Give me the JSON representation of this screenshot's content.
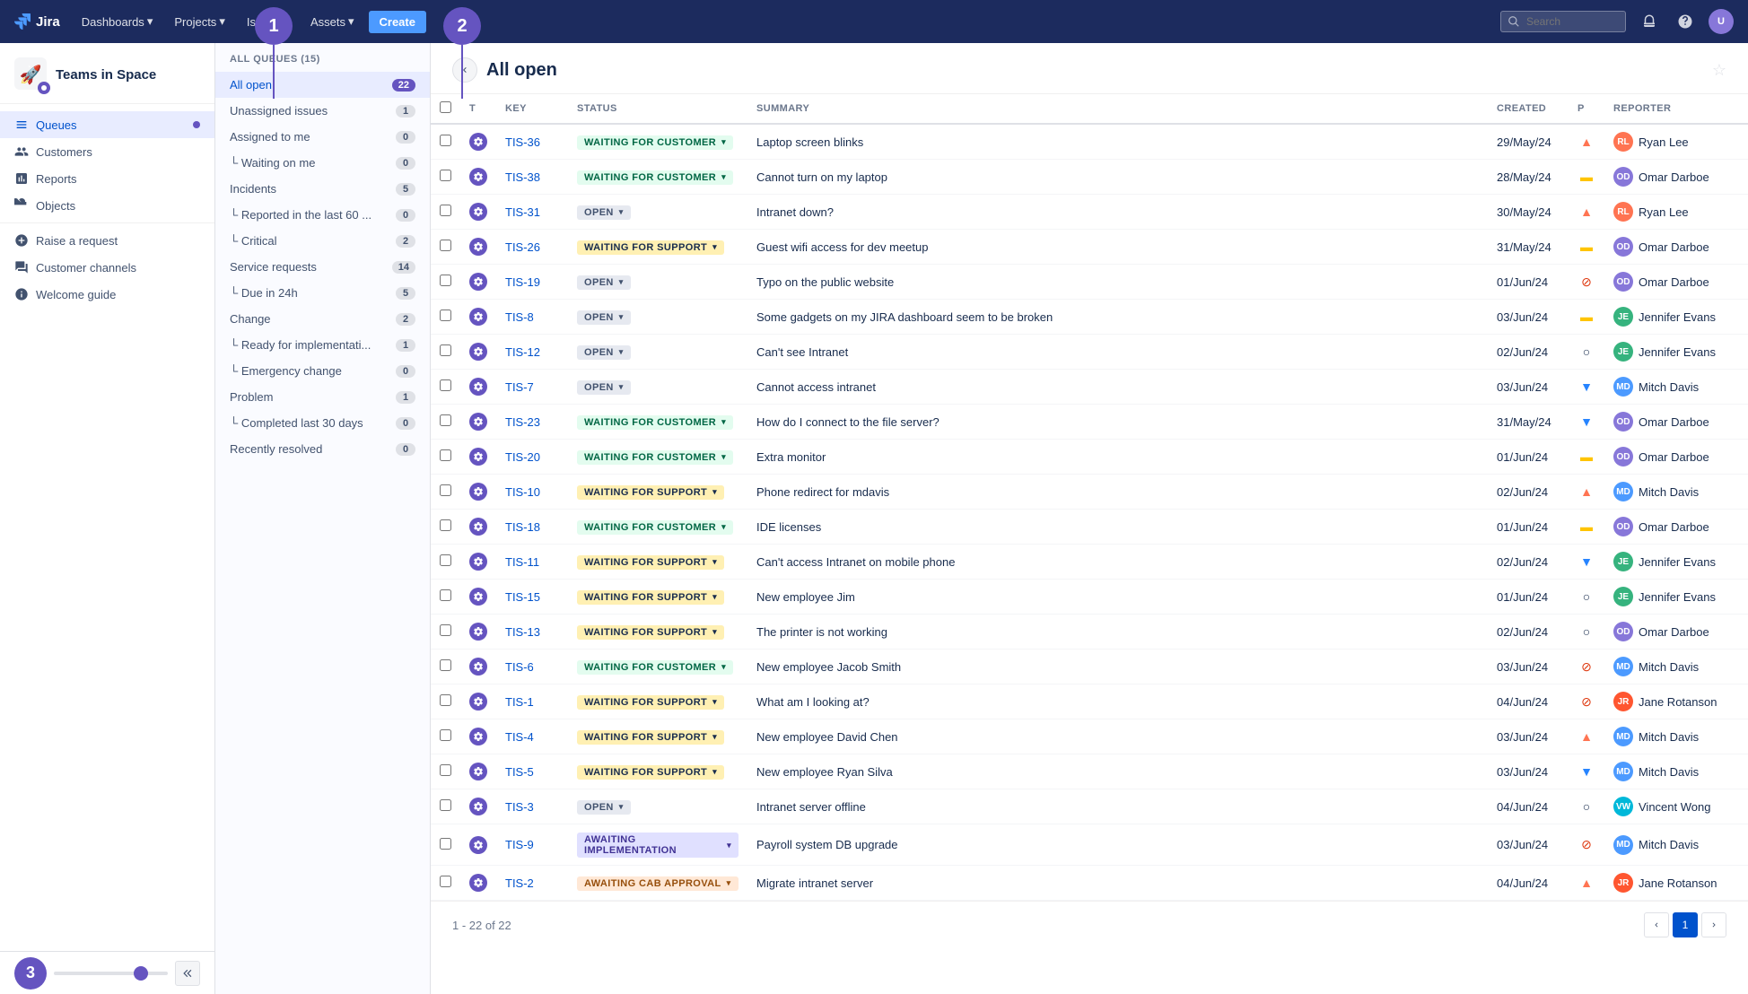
{
  "topnav": {
    "logo_text": "Jira",
    "dashboards": "Dashboards",
    "projects": "Projects",
    "issues": "Issues",
    "assets": "Assets",
    "create": "Create",
    "search_placeholder": "Search"
  },
  "sidebar": {
    "project_name": "Teams in Space",
    "nav_items": [
      {
        "id": "queues",
        "label": "Queues",
        "active": true
      },
      {
        "id": "customers",
        "label": "Customers",
        "active": false
      },
      {
        "id": "reports",
        "label": "Reports",
        "active": false
      },
      {
        "id": "objects",
        "label": "Objects",
        "active": false
      }
    ],
    "actions": [
      {
        "id": "raise-request",
        "label": "Raise a request"
      },
      {
        "id": "customer-channels",
        "label": "Customer channels"
      },
      {
        "id": "welcome-guide",
        "label": "Welcome guide"
      }
    ]
  },
  "queues_panel": {
    "header": "ALL QUEUES (15)",
    "items": [
      {
        "id": "all-open",
        "label": "All open",
        "count": "22",
        "indent": false,
        "active": true
      },
      {
        "id": "unassigned",
        "label": "Unassigned issues",
        "count": "1",
        "indent": false,
        "active": false
      },
      {
        "id": "assigned-to-me",
        "label": "Assigned to me",
        "count": "0",
        "indent": false,
        "active": false
      },
      {
        "id": "waiting-on-me",
        "label": "└ Waiting on me",
        "count": "0",
        "indent": true,
        "active": false
      },
      {
        "id": "incidents",
        "label": "Incidents",
        "count": "5",
        "indent": false,
        "active": false
      },
      {
        "id": "reported-last-60",
        "label": "└ Reported in the last 60 ...",
        "count": "0",
        "indent": true,
        "active": false
      },
      {
        "id": "critical",
        "label": "└ Critical",
        "count": "2",
        "indent": true,
        "active": false
      },
      {
        "id": "service-requests",
        "label": "Service requests",
        "count": "14",
        "indent": false,
        "active": false
      },
      {
        "id": "due-24h",
        "label": "└ Due in 24h",
        "count": "5",
        "indent": true,
        "active": false
      },
      {
        "id": "change",
        "label": "Change",
        "count": "2",
        "indent": false,
        "active": false
      },
      {
        "id": "ready-impl",
        "label": "└ Ready for implementati...",
        "count": "1",
        "indent": true,
        "active": false
      },
      {
        "id": "emergency-change",
        "label": "└ Emergency change",
        "count": "0",
        "indent": true,
        "active": false
      },
      {
        "id": "problem",
        "label": "Problem",
        "count": "1",
        "indent": false,
        "active": false
      },
      {
        "id": "completed-30",
        "label": "└ Completed last 30 days",
        "count": "0",
        "indent": true,
        "active": false
      },
      {
        "id": "recently-resolved",
        "label": "Recently resolved",
        "count": "0",
        "indent": false,
        "active": false
      }
    ]
  },
  "content": {
    "title": "All open",
    "pagination_info": "1 - 22 of 22",
    "current_page": "1",
    "columns": [
      "",
      "T",
      "Key",
      "Status",
      "Summary",
      "Created",
      "P",
      "Reporter"
    ],
    "issues": [
      {
        "key": "TIS-36",
        "status": "WAITING FOR CUSTOMER",
        "status_type": "waiting-customer",
        "summary": "Laptop screen blinks",
        "created": "29/May/24",
        "priority": "high",
        "reporter": "Ryan Lee",
        "reporter_av": "RL",
        "reporter_class": "av-ryan"
      },
      {
        "key": "TIS-38",
        "status": "WAITING FOR CUSTOMER",
        "status_type": "waiting-customer",
        "summary": "Cannot turn on my laptop",
        "created": "28/May/24",
        "priority": "medium",
        "reporter": "Omar Darboe",
        "reporter_av": "OD",
        "reporter_class": "av-omar"
      },
      {
        "key": "TIS-31",
        "status": "OPEN",
        "status_type": "open",
        "summary": "Intranet down?",
        "created": "30/May/24",
        "priority": "high",
        "reporter": "Ryan Lee",
        "reporter_av": "RL",
        "reporter_class": "av-ryan"
      },
      {
        "key": "TIS-26",
        "status": "WAITING FOR SUPPORT",
        "status_type": "waiting-support",
        "summary": "Guest wifi access for dev meetup",
        "created": "31/May/24",
        "priority": "medium",
        "reporter": "Omar Darboe",
        "reporter_av": "OD",
        "reporter_class": "av-omar"
      },
      {
        "key": "TIS-19",
        "status": "OPEN",
        "status_type": "open",
        "summary": "Typo on the public website",
        "created": "01/Jun/24",
        "priority": "stop",
        "reporter": "Omar Darboe",
        "reporter_av": "OD",
        "reporter_class": "av-omar"
      },
      {
        "key": "TIS-8",
        "status": "OPEN",
        "status_type": "open",
        "summary": "Some gadgets on my JIRA dashboard seem to be broken",
        "created": "03/Jun/24",
        "priority": "medium",
        "reporter": "Jennifer Evans",
        "reporter_av": "JE",
        "reporter_class": "av-jennifer"
      },
      {
        "key": "TIS-12",
        "status": "OPEN",
        "status_type": "open",
        "summary": "Can't see Intranet",
        "created": "02/Jun/24",
        "priority": "none",
        "reporter": "Jennifer Evans",
        "reporter_av": "JE",
        "reporter_class": "av-jennifer"
      },
      {
        "key": "TIS-7",
        "status": "OPEN",
        "status_type": "open",
        "summary": "Cannot access intranet",
        "created": "03/Jun/24",
        "priority": "low",
        "reporter": "Mitch Davis",
        "reporter_av": "MD",
        "reporter_class": "av-mitch"
      },
      {
        "key": "TIS-23",
        "status": "WAITING FOR CUSTOMER",
        "status_type": "waiting-customer",
        "summary": "How do I connect to the file server?",
        "created": "31/May/24",
        "priority": "low",
        "reporter": "Omar Darboe",
        "reporter_av": "OD",
        "reporter_class": "av-omar"
      },
      {
        "key": "TIS-20",
        "status": "WAITING FOR CUSTOMER",
        "status_type": "waiting-customer",
        "summary": "Extra monitor",
        "created": "01/Jun/24",
        "priority": "medium",
        "reporter": "Omar Darboe",
        "reporter_av": "OD",
        "reporter_class": "av-omar"
      },
      {
        "key": "TIS-10",
        "status": "WAITING FOR SUPPORT",
        "status_type": "waiting-support",
        "summary": "Phone redirect for mdavis",
        "created": "02/Jun/24",
        "priority": "high",
        "reporter": "Mitch Davis",
        "reporter_av": "MD",
        "reporter_class": "av-mitch"
      },
      {
        "key": "TIS-18",
        "status": "WAITING FOR CUSTOMER",
        "status_type": "waiting-customer",
        "summary": "IDE licenses",
        "created": "01/Jun/24",
        "priority": "medium",
        "reporter": "Omar Darboe",
        "reporter_av": "OD",
        "reporter_class": "av-omar"
      },
      {
        "key": "TIS-11",
        "status": "WAITING FOR SUPPORT",
        "status_type": "waiting-support",
        "summary": "Can't access Intranet on mobile phone",
        "created": "02/Jun/24",
        "priority": "low",
        "reporter": "Jennifer Evans",
        "reporter_av": "JE",
        "reporter_class": "av-jennifer"
      },
      {
        "key": "TIS-15",
        "status": "WAITING FOR SUPPORT",
        "status_type": "waiting-support",
        "summary": "New employee Jim",
        "created": "01/Jun/24",
        "priority": "none",
        "reporter": "Jennifer Evans",
        "reporter_av": "JE",
        "reporter_class": "av-jennifer"
      },
      {
        "key": "TIS-13",
        "status": "WAITING FOR SUPPORT",
        "status_type": "waiting-support",
        "summary": "The printer is not working",
        "created": "02/Jun/24",
        "priority": "none",
        "reporter": "Omar Darboe",
        "reporter_av": "OD",
        "reporter_class": "av-omar"
      },
      {
        "key": "TIS-6",
        "status": "WAITING FOR CUSTOMER",
        "status_type": "waiting-customer",
        "summary": "New employee Jacob Smith",
        "created": "03/Jun/24",
        "priority": "stop",
        "reporter": "Mitch Davis",
        "reporter_av": "MD",
        "reporter_class": "av-mitch"
      },
      {
        "key": "TIS-1",
        "status": "WAITING FOR SUPPORT",
        "status_type": "waiting-support",
        "summary": "What am I looking at?",
        "created": "04/Jun/24",
        "priority": "stop",
        "reporter": "Jane Rotanson",
        "reporter_av": "JR",
        "reporter_class": "av-jane"
      },
      {
        "key": "TIS-4",
        "status": "WAITING FOR SUPPORT",
        "status_type": "waiting-support",
        "summary": "New employee David Chen",
        "created": "03/Jun/24",
        "priority": "high",
        "reporter": "Mitch Davis",
        "reporter_av": "MD",
        "reporter_class": "av-mitch"
      },
      {
        "key": "TIS-5",
        "status": "WAITING FOR SUPPORT",
        "status_type": "waiting-support",
        "summary": "New employee Ryan Silva",
        "created": "03/Jun/24",
        "priority": "low",
        "reporter": "Mitch Davis",
        "reporter_av": "MD",
        "reporter_class": "av-mitch"
      },
      {
        "key": "TIS-3",
        "status": "OPEN",
        "status_type": "open",
        "summary": "Intranet server offline",
        "created": "04/Jun/24",
        "priority": "none",
        "reporter": "Vincent Wong",
        "reporter_av": "VW",
        "reporter_class": "av-vincent"
      },
      {
        "key": "TIS-9",
        "status": "AWAITING IMPLEMENTATION",
        "status_type": "awaiting-impl",
        "summary": "Payroll system DB upgrade",
        "created": "03/Jun/24",
        "priority": "stop",
        "reporter": "Mitch Davis",
        "reporter_av": "MD",
        "reporter_class": "av-mitch"
      },
      {
        "key": "TIS-2",
        "status": "AWAITING CAB APPROVAL",
        "status_type": "awaiting-cab",
        "summary": "Migrate intranet server",
        "created": "04/Jun/24",
        "priority": "high",
        "reporter": "Jane Rotanson",
        "reporter_av": "JR",
        "reporter_class": "av-jane"
      }
    ]
  },
  "annotations": {
    "1": "1",
    "2": "2",
    "3": "3"
  }
}
